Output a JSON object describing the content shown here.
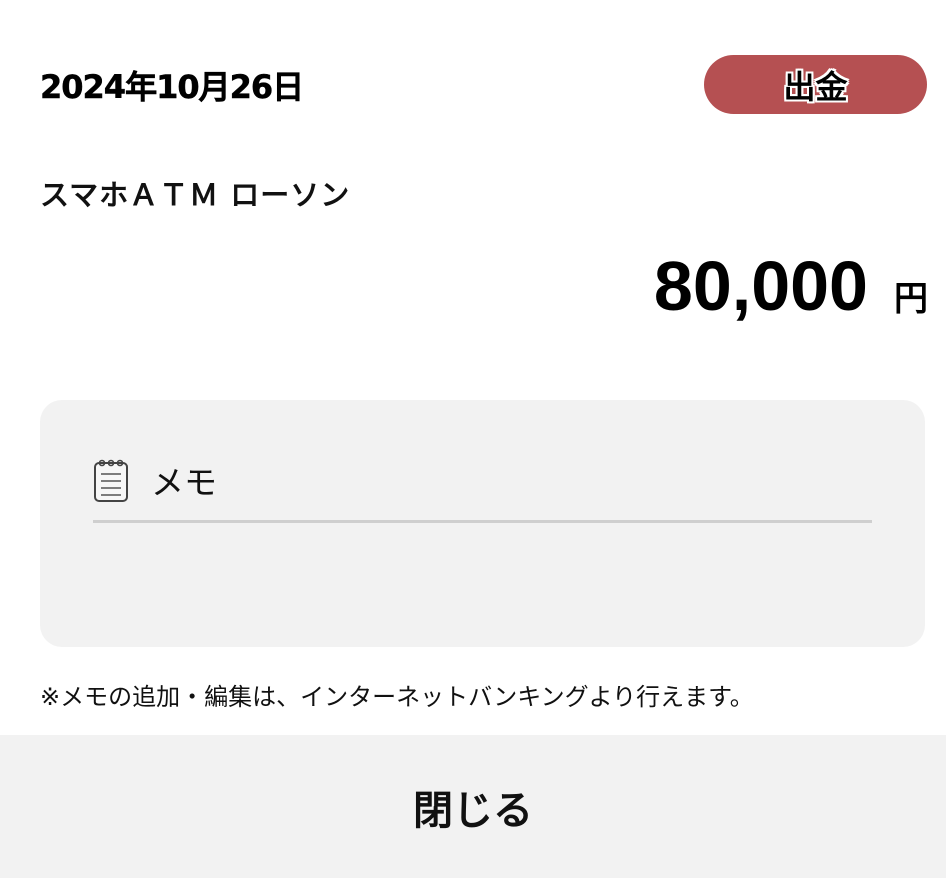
{
  "header": {
    "date": "2024年10月26日",
    "type_badge": "出金",
    "badge_color": "#b55052"
  },
  "transaction": {
    "merchant": "スマホＡＴＭ ローソン",
    "amount": "80,000",
    "currency_unit": "円"
  },
  "memo": {
    "icon": "notepad-icon",
    "label": "メモ",
    "value": ""
  },
  "note": "※メモの追加・編集は、インターネットバンキングより行えます。",
  "footer": {
    "close_label": "閉じる"
  }
}
